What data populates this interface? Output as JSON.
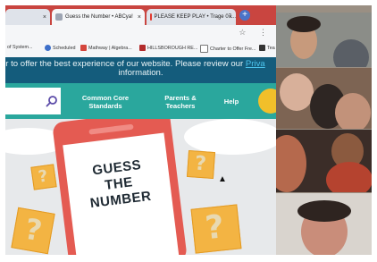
{
  "browser": {
    "tabs": [
      {
        "label": "",
        "active": false
      },
      {
        "label": "Guess the Number • ABCya!",
        "active": true
      },
      {
        "label": "PLEASE KEEP PLAY • Trage 07...",
        "active": false
      }
    ],
    "new_tab_label": "+",
    "bookmarks": [
      {
        "label": "of System..."
      },
      {
        "label": "Scheduled"
      },
      {
        "label": "Mathway | Algebra..."
      },
      {
        "label": "HILLSBOROUGH RE..."
      },
      {
        "label": "Charter to Offer Fre..."
      },
      {
        "label": "Tea"
      }
    ],
    "address_icons": "☆ ⋮"
  },
  "site": {
    "cookie_line1": "r to offer the best experience of our website. Please review our ",
    "cookie_link": "Priva",
    "cookie_line2": "information.",
    "nav": {
      "common_core": "Common Core Standards",
      "parents_teachers": "Parents & Teachers",
      "help": "Help"
    },
    "game_title_line1": "GUESS",
    "game_title_line2": "THE",
    "game_title_line3": "NUMBER",
    "question_mark": "?"
  },
  "colors": {
    "border": "#b84a43",
    "site_nav": "#2aa79d",
    "cookie_banner": "#145c7c",
    "phone": "#e45b52",
    "question_box": "#f3b443"
  }
}
